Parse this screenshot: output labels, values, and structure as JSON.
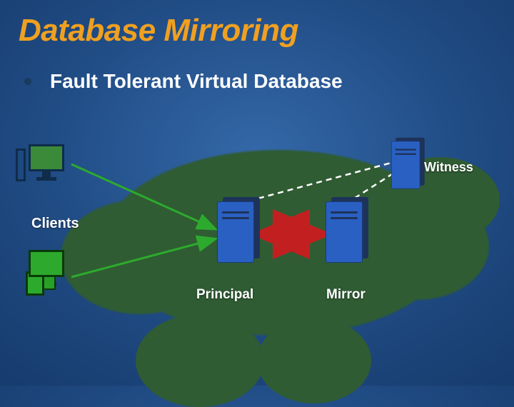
{
  "title": "Database Mirroring",
  "bullet": "Fault Tolerant Virtual Database",
  "labels": {
    "witness": "Witness",
    "principal": "Principal",
    "mirror": "Mirror",
    "clients": "Clients"
  },
  "colors": {
    "title": "#f0a020",
    "cloud": "#2f5c33",
    "server": "#2a60c2",
    "arrow": "#c22020"
  }
}
